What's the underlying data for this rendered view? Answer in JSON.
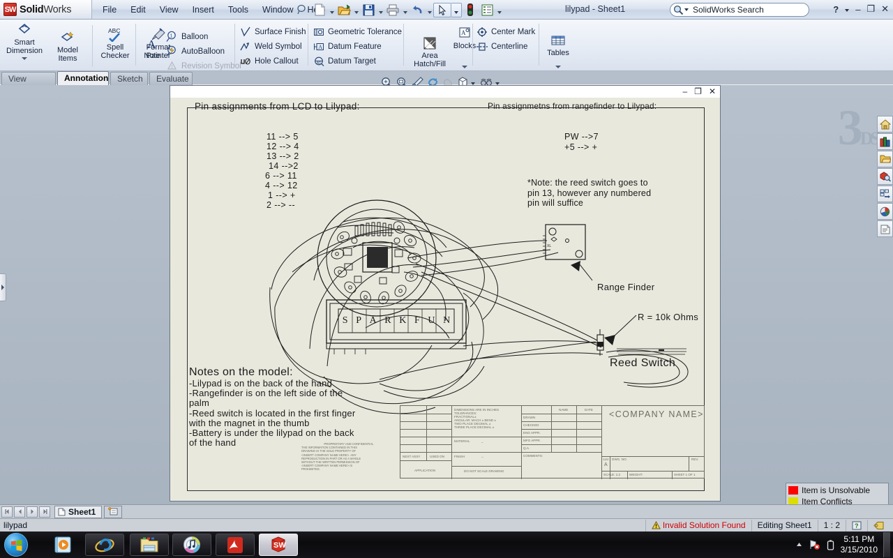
{
  "window": {
    "brand_bold": "Solid",
    "brand_light": "Works",
    "document_title": "lilypad - Sheet1",
    "help_glyph": "?",
    "minimize_glyph": "–",
    "restore_glyph": "❐",
    "close_glyph": "✕"
  },
  "menu": {
    "items": [
      {
        "label": "File"
      },
      {
        "label": "Edit"
      },
      {
        "label": "View"
      },
      {
        "label": "Insert"
      },
      {
        "label": "Tools"
      },
      {
        "label": "Window"
      },
      {
        "label": "Help"
      }
    ]
  },
  "quick_access": {
    "buttons": [
      {
        "name": "new-document-icon"
      },
      {
        "name": "open-document-icon"
      },
      {
        "name": "save-icon"
      },
      {
        "name": "print-icon"
      },
      {
        "name": "undo-icon"
      },
      {
        "name": "select-icon"
      },
      {
        "name": "rebuild-icon"
      },
      {
        "name": "options-icon"
      }
    ]
  },
  "search": {
    "value": "SolidWorks Search",
    "placeholder": "SolidWorks Search"
  },
  "ribbon": {
    "groups": [
      {
        "name": "annotate",
        "big_buttons": [
          {
            "label": "Smart\nDimension",
            "icon": "smart-dimension-icon",
            "has_dropdown": true
          },
          {
            "label": "Model\nItems",
            "icon": "model-items-icon",
            "has_dropdown": false
          },
          {
            "label": "Spell\nChecker",
            "icon": "spell-checker-icon",
            "has_dropdown": false
          },
          {
            "label": "Format\nPainter",
            "icon": "format-painter-icon",
            "has_dropdown": false
          },
          {
            "label": "Note",
            "icon": "note-icon",
            "has_dropdown": false
          }
        ]
      }
    ],
    "small_items_1": [
      {
        "label": "Balloon",
        "icon": "balloon-icon",
        "disabled": false
      },
      {
        "label": "AutoBalloon",
        "icon": "autoballoon-icon",
        "disabled": false
      },
      {
        "label": "Revision Symbol",
        "icon": "revision-symbol-icon",
        "disabled": true
      }
    ],
    "small_items_2": [
      {
        "label": "Surface Finish",
        "icon": "surface-finish-icon",
        "disabled": false
      },
      {
        "label": "Weld Symbol",
        "icon": "weld-symbol-icon",
        "disabled": false
      },
      {
        "label": "Hole Callout",
        "icon": "hole-callout-icon",
        "disabled": false
      }
    ],
    "small_items_3": [
      {
        "label": "Geometric Tolerance",
        "icon": "geometric-tolerance-icon",
        "disabled": false
      },
      {
        "label": "Datum Feature",
        "icon": "datum-feature-icon",
        "disabled": false
      },
      {
        "label": "Datum Target",
        "icon": "datum-target-icon",
        "disabled": false
      }
    ],
    "small_items_4": [
      {
        "label": "Center Mark",
        "icon": "center-mark-icon",
        "disabled": false
      },
      {
        "label": "Centerline",
        "icon": "centerline-icon",
        "disabled": false
      }
    ],
    "area_hatch": {
      "label": "Area\nHatch/Fill",
      "icon": "area-hatch-icon"
    },
    "blocks": {
      "label": "Blocks",
      "icon": "blocks-icon"
    },
    "tables": {
      "label": "Tables",
      "icon": "tables-icon"
    }
  },
  "command_tabs": [
    {
      "label": "View Layout",
      "active": false
    },
    {
      "label": "Annotation",
      "active": true
    },
    {
      "label": "Sketch",
      "active": false
    },
    {
      "label": "Evaluate",
      "active": false
    }
  ],
  "view_toolbar": [
    {
      "name": "zoom-to-fit-icon"
    },
    {
      "name": "zoom-to-area-icon"
    },
    {
      "name": "zoom-in-out-icon"
    },
    {
      "name": "rotate-view-icon"
    },
    {
      "name": "pan-icon"
    },
    {
      "name": "display-style-icon"
    },
    {
      "name": "view-orientation-icon"
    }
  ],
  "sheet_window_controls": {
    "minimize": "–",
    "restore": "❐",
    "close": "✕"
  },
  "drawing": {
    "heading_left": "Pin assignments from LCD to Lilypad:",
    "heading_right": "Pin assignmetns from rangefinder to Lilypad:",
    "lcd_pins": [
      "11 --> 5",
      "12 --> 4",
      "13 --> 2",
      "14 -->2",
      "6 --> 11",
      "4 --> 12",
      "1 --> +",
      "2 --> --"
    ],
    "rangefinder_pins": [
      "PW -->7",
      "+5 -->  +"
    ],
    "note_reed": "*Note: the reed switch goes to\npin 13, however any numbered\npin will suffice",
    "label_range_finder": "Range Finder",
    "label_resistor": "R = 10k Ohms",
    "label_reed_switch": "Reed Switch",
    "lcd_letters": [
      "S",
      "P",
      "A",
      "R",
      "K",
      "F",
      "U",
      "N"
    ],
    "notes_title": "Notes on the model:",
    "notes_lines": [
      "-Lilypad is on the back of the hand",
      "-Rangefinder is on the left side of the",
      "palm",
      "-Reed switch is located in the first finger",
      "with the magnet in the thumb",
      "-Battery is under the lilypad on the back",
      "of the hand"
    ]
  },
  "title_block": {
    "company_name": "<COMPANY NAME>",
    "tolerance_block": [
      "DIMENSIONS ARE IN INCHES",
      "TOLERANCES:",
      "FRACTIONAL±",
      "ANGULAR: MACH ±   BEND ±",
      "TWO PLACE DECIMAL    ±",
      "THREE PLACE DECIMAL  ±"
    ],
    "name_header": "NAME",
    "date_header": "DATE",
    "rows": [
      "DRAWN",
      "CHECKED",
      "ENG APPR.",
      "MFG APPR.",
      "Q.A.",
      "COMMENTS:"
    ],
    "material_label": "MATERIAL",
    "material_value": "_",
    "finish_label": "FINISH",
    "finish_value": "--",
    "next_assy": "NEXT ASSY",
    "used_on": "USED ON",
    "application": "APPLICATION",
    "do_not_scale": "DO NOT SCALE DRAWING",
    "size_label": "SIZE",
    "size_value": "A",
    "dwg_no_label": "DWG.  NO.",
    "rev_label": "REV.",
    "scale_label": "SCALE: 1:2",
    "weight_label": "WEIGHT:",
    "sheet_label": "SHEET 1 OF 1"
  },
  "task_pane": [
    {
      "name": "sw-resources-icon"
    },
    {
      "name": "design-library-icon"
    },
    {
      "name": "file-explorer-icon"
    },
    {
      "name": "search-pane-icon"
    },
    {
      "name": "view-palette-icon"
    },
    {
      "name": "appearances-icon"
    },
    {
      "name": "custom-properties-icon"
    }
  ],
  "legend": {
    "items": [
      {
        "label": "Item is Unsolvable",
        "color": "#ff0000"
      },
      {
        "label": "Item Conflicts",
        "color": "#dddd00"
      }
    ]
  },
  "sheet_tabs": {
    "nav": [
      "first",
      "prev",
      "next",
      "last"
    ],
    "tabs": [
      {
        "label": "Sheet1",
        "active": true
      }
    ],
    "add_tab_name": "add-sheet-tab"
  },
  "status_bar": {
    "document_name": "lilypad",
    "warning": "Invalid Solution Found",
    "editing": "Editing Sheet1",
    "scale": "1 : 2",
    "help_glyph": "?"
  },
  "taskbar": {
    "items": [
      {
        "name": "media-player",
        "active": false,
        "plain": true
      },
      {
        "name": "internet-explorer",
        "active": false,
        "plain": false
      },
      {
        "name": "windows-explorer",
        "active": false,
        "plain": false
      },
      {
        "name": "itunes",
        "active": false,
        "plain": false
      },
      {
        "name": "adobe-reader",
        "active": false,
        "plain": false
      },
      {
        "name": "solidworks",
        "active": true,
        "plain": false
      }
    ],
    "clock_time": "5:11 PM",
    "clock_date": "3/15/2010"
  }
}
